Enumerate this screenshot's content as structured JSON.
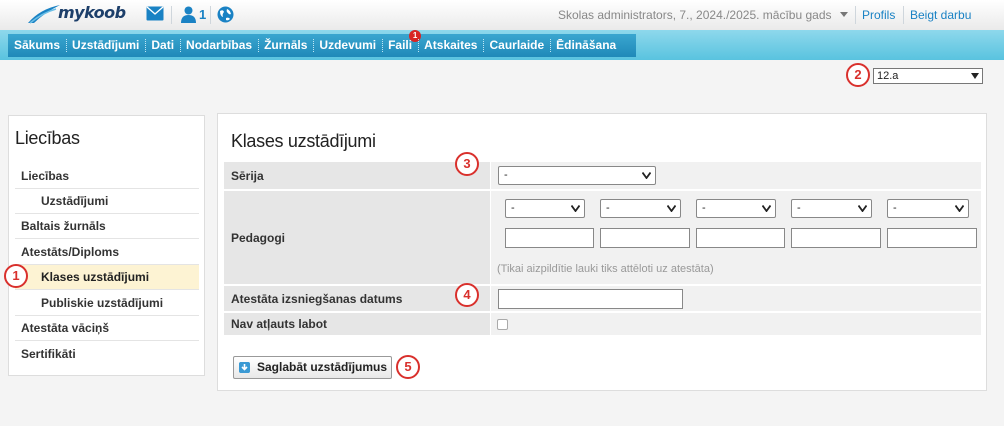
{
  "app": {
    "logo_text": "mykoob"
  },
  "topbar": {
    "user_count": "1",
    "school_info": "Skolas administrators, 7., 2024./2025. mācību gads",
    "profile_link": "Profils",
    "logout_link": "Beigt darbu"
  },
  "nav": {
    "items": [
      {
        "label": "Sākums"
      },
      {
        "label": "Uzstādījumi"
      },
      {
        "label": "Dati"
      },
      {
        "label": "Nodarbības"
      },
      {
        "label": "Žurnāls"
      },
      {
        "label": "Uzdevumi"
      },
      {
        "label": "Faili",
        "badge": "1"
      },
      {
        "label": "Atskaites"
      },
      {
        "label": "Caurlaide"
      },
      {
        "label": "Ēdināšana"
      }
    ]
  },
  "class_select": {
    "value": "12.a"
  },
  "markers": [
    "1",
    "2",
    "3",
    "4",
    "5"
  ],
  "sidebar": {
    "title": "Liecības",
    "items": [
      {
        "label": "Liecības"
      },
      {
        "label": "Uzstādījumi"
      },
      {
        "label": "Baltais žurnāls"
      },
      {
        "label": "Atestāts/Diploms"
      },
      {
        "label": "Klases uzstādījumi"
      },
      {
        "label": "Publiskie uzstādījumi"
      },
      {
        "label": "Atestāta vāciņš"
      },
      {
        "label": "Sertifikāti"
      }
    ]
  },
  "main": {
    "title": "Klases uzstādījumi",
    "series_label": "Sērija",
    "series_value": "-",
    "teachers_label": "Pedagogi",
    "teacher_selects": [
      "-",
      "-",
      "-",
      "-",
      "-"
    ],
    "teachers_hint": "(Tikai aizpildītie lauki tiks attēloti uz atestāta)",
    "date_label": "Atestāta izsniegšanas datums",
    "no_edit_label": "Nav atļauts labot",
    "save_label": "Saglabāt uzstādījumus"
  },
  "colors": {
    "accent": "#1f89b9",
    "marker": "#d9302c",
    "active_row": "#fdf3d3"
  }
}
